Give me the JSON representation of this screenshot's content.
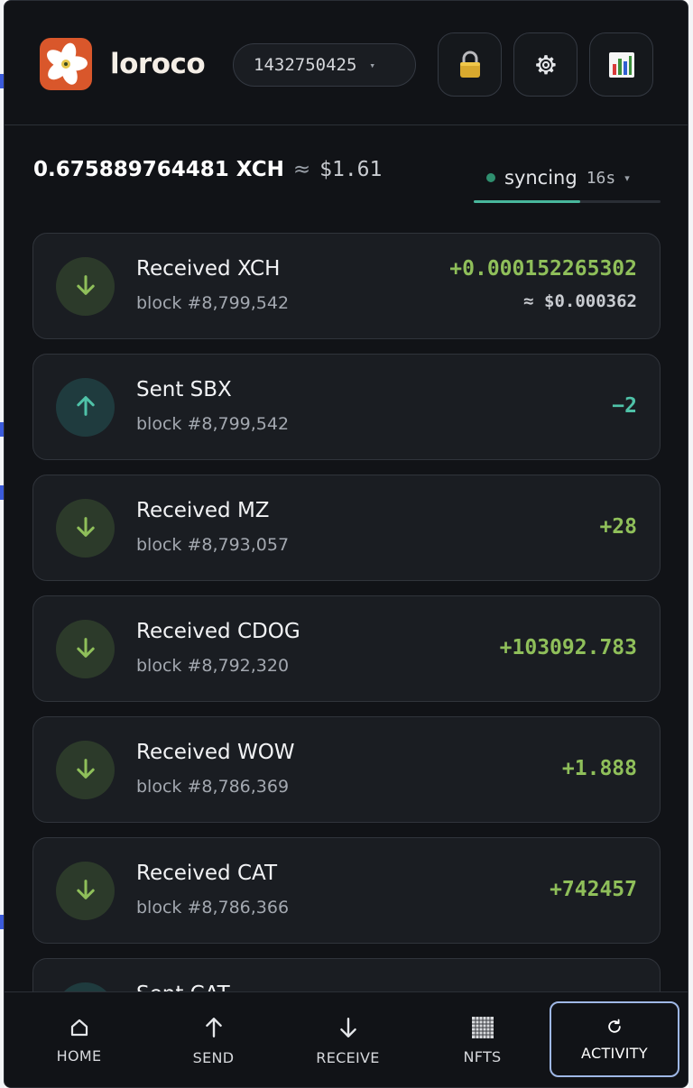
{
  "header": {
    "brand": "loroco",
    "account_id": "1432750425",
    "icons": {
      "logo": "loroco-flower-logo",
      "lock": "lock-icon",
      "settings": "gear-icon",
      "stats": "bar-chart-icon"
    }
  },
  "balance": {
    "amount": "0.675889764481 XCH",
    "approx_symbol": "≈",
    "usd": "$1.61"
  },
  "sync": {
    "status": "syncing",
    "elapsed": "16s",
    "progress": 0.57,
    "dot_color": "#2f8f6f"
  },
  "transactions": [
    {
      "direction": "received",
      "title": "Received XCH",
      "block": "block #8,799,542",
      "amount": "+0.000152265302",
      "usd": "≈ $0.000362"
    },
    {
      "direction": "sent",
      "title": "Sent SBX",
      "block": "block #8,799,542",
      "amount": "−2",
      "usd": ""
    },
    {
      "direction": "received",
      "title": "Received MZ",
      "block": "block #8,793,057",
      "amount": "+28",
      "usd": ""
    },
    {
      "direction": "received",
      "title": "Received CDOG",
      "block": "block #8,792,320",
      "amount": "+103092.783",
      "usd": ""
    },
    {
      "direction": "received",
      "title": "Received WOW",
      "block": "block #8,786,369",
      "amount": "+1.888",
      "usd": ""
    },
    {
      "direction": "received",
      "title": "Received CAT",
      "block": "block #8,786,366",
      "amount": "+742457",
      "usd": ""
    },
    {
      "direction": "sent",
      "title": "Sent CAT",
      "block": "",
      "amount": "",
      "usd": ""
    }
  ],
  "nav": {
    "items": [
      {
        "key": "home",
        "label": "HOME",
        "icon": "home-icon"
      },
      {
        "key": "send",
        "label": "SEND",
        "icon": "arrow-up-icon"
      },
      {
        "key": "receive",
        "label": "RECEIVE",
        "icon": "arrow-down-icon"
      },
      {
        "key": "nfts",
        "label": "NFTS",
        "icon": "grid-icon"
      },
      {
        "key": "activity",
        "label": "ACTIVITY",
        "icon": "refresh-icon"
      }
    ],
    "active": "activity"
  },
  "colors": {
    "background": "#111317",
    "card": "#1a1d22",
    "positive": "#8fbf5a",
    "negative": "#4fc2a8",
    "accent_outline": "#9fb8e6"
  }
}
